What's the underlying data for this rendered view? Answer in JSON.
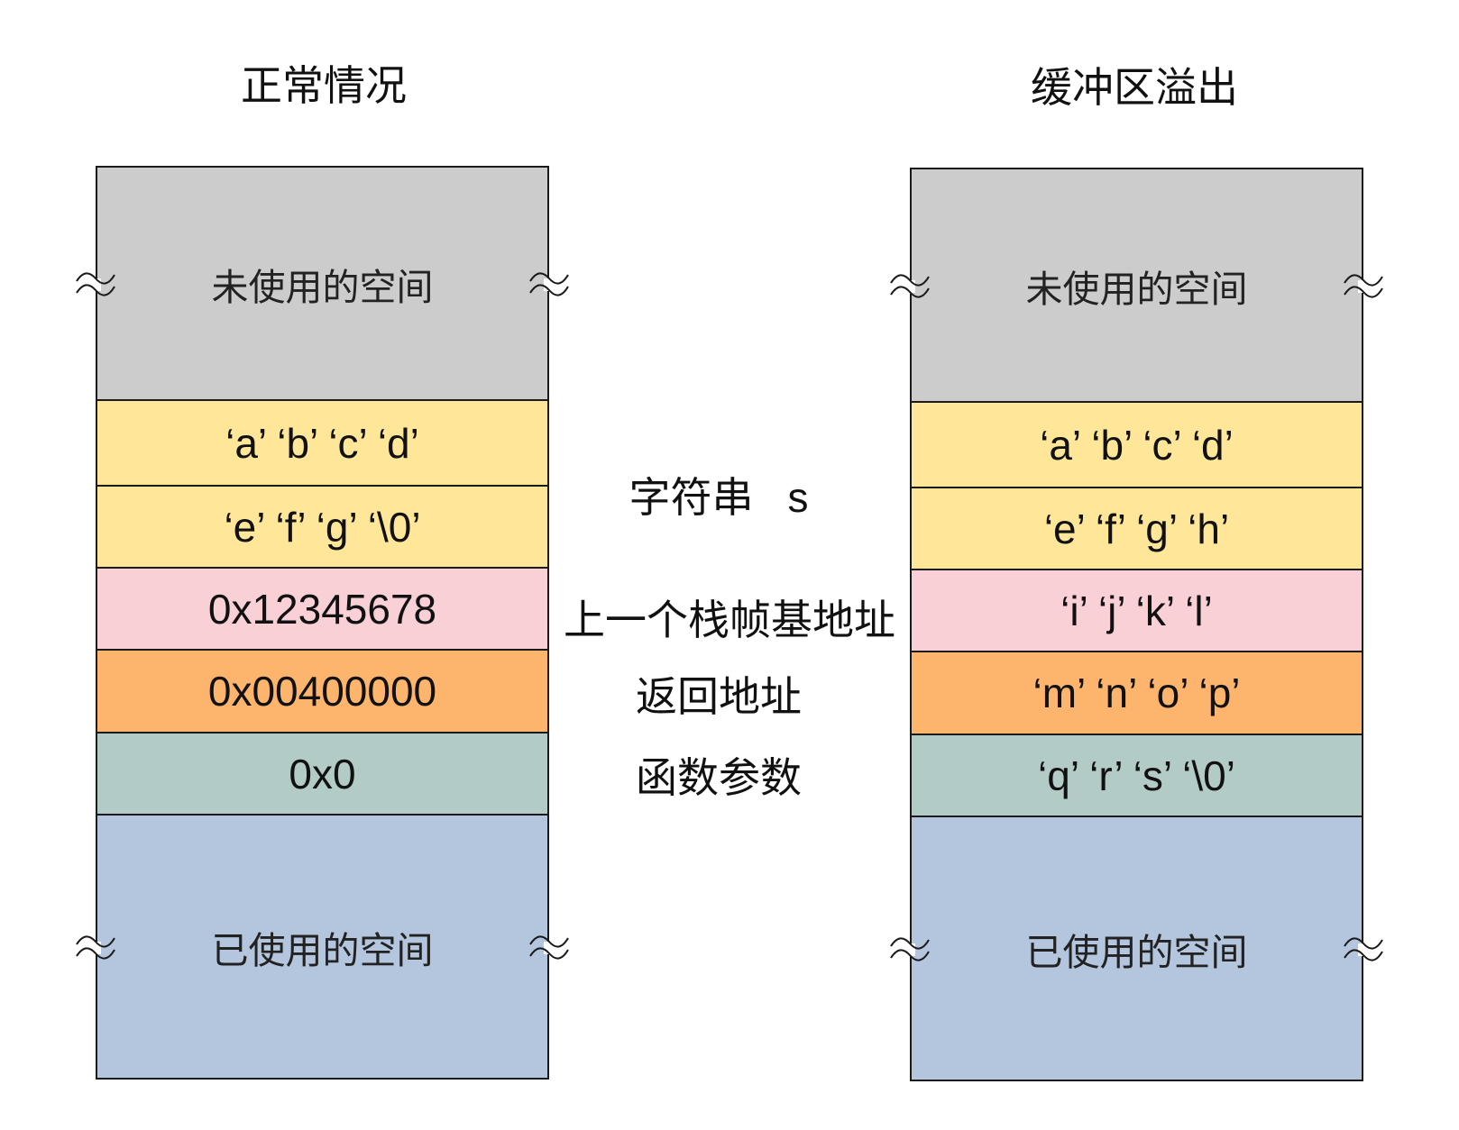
{
  "titles": {
    "normal": "正常情况",
    "overflow": "缓冲区溢出"
  },
  "normal_stack": {
    "cells": [
      "未使用的空间",
      "‘a’ ‘b’ ‘c’ ‘d’",
      "‘e’ ‘f’ ‘g’ ‘\\0’",
      "0x12345678",
      "0x00400000",
      "0x0",
      "已使用的空间"
    ]
  },
  "overflow_stack": {
    "cells": [
      "未使用的空间",
      "‘a’ ‘b’ ‘c’ ‘d’",
      "‘e’ ‘f’ ‘g’ ‘h’",
      "‘i’ ‘j’ ‘k’ ‘l’",
      "‘m’ ‘n’ ‘o’ ‘p’",
      "‘q’ ‘r’ ‘s’ ‘\\0’",
      "已使用的空间"
    ]
  },
  "labels": {
    "string": "字符串",
    "string_var": "s",
    "prev_frame": "上一个栈帧基地址",
    "return_address": "返回地址",
    "func_args": "函数参数"
  },
  "colors": {
    "unused": "#cccccc",
    "string": "#ffe699",
    "frame": "#f8d0d6",
    "return": "#fdb46c",
    "args": "#b3cbc6",
    "used": "#b4c6de"
  }
}
